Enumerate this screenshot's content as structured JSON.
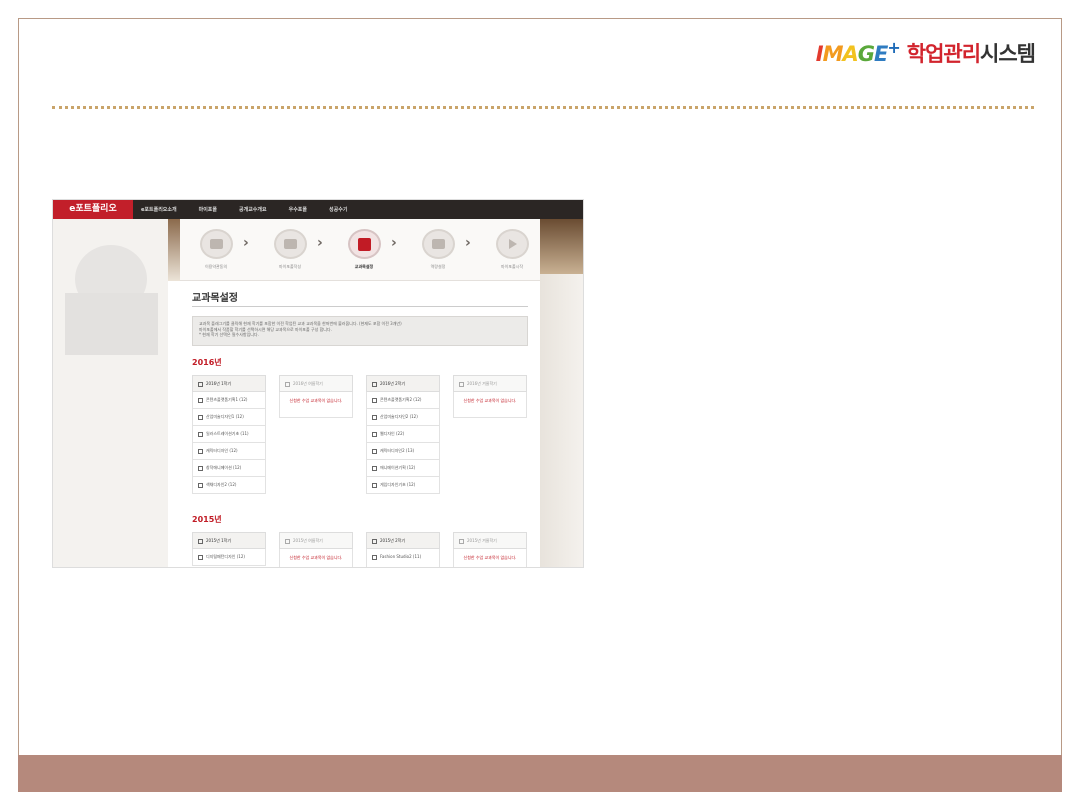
{
  "logo": {
    "brand_letters": [
      {
        "char": "I",
        "color": "#e23a2e"
      },
      {
        "char": "M",
        "color": "#f29a1f"
      },
      {
        "char": "A",
        "color": "#f2c21f"
      },
      {
        "char": "G",
        "color": "#5aa83b"
      },
      {
        "char": "E",
        "color": "#2f7cc1"
      }
    ],
    "plus": "+",
    "system_red": "학업관리",
    "system_dark": "시스템"
  },
  "colors": {
    "accent": "#c11b25",
    "footer": "#b5897c",
    "dotted": "#c9a46a"
  },
  "screenshot": {
    "nav": {
      "brand": "e포트폴리오",
      "menu": [
        "e포트폴리오소개",
        "마이포폴",
        "공개교수개요",
        "우수포폴",
        "성공수기"
      ]
    },
    "steps": [
      {
        "label": "이용약관동의",
        "icon": "check-icon"
      },
      {
        "label": "마이포폴작성",
        "icon": "keyboard-icon"
      },
      {
        "label": "교과목설정",
        "icon": "book-icon",
        "active": true
      },
      {
        "label": "역량설정",
        "icon": "list-icon"
      },
      {
        "label": "마이포폴시작",
        "icon": "play-icon"
      }
    ],
    "page_title": "교과목설정",
    "info_lines": [
      "교과목 플래그기를 클릭해 현재 학기를 포함한 이전 학업된 교과 교과목을 한꺼번에 불러옵니다. (현재도 포함 이전 3개년)",
      "마이포폴에서 작품할 학기를 선택하시면 해당 교과목으로 마이포폴 구성 합니다.",
      "* 현재 학기 선택은 필수사항입니다."
    ],
    "years": [
      {
        "label": "2016년",
        "semesters": [
          {
            "label": "2016년 1학기",
            "muted": false,
            "courses": [
              "콘텐츠플랫폼기획1 (12)",
              "산업미술디자인1 (12)",
              "일러스트레이션기초 (11)",
              "캐릭터디자인 (12)",
              "창작애니메이션 (12)",
              "색채디자인2 (12)"
            ]
          },
          {
            "label": "2016년 여름학기",
            "muted": true,
            "empty_note": "신청한 수업 교과목이 없습니다."
          },
          {
            "label": "2016년 2학기",
            "muted": false,
            "courses": [
              "콘텐츠플랫폼기획2 (12)",
              "산업미술디자인2 (12)",
              "웹디자인 (22)",
              "캐릭터디자인2 (13)",
              "애니메이션기획 (12)",
              "게임디자인기초 (12)"
            ]
          },
          {
            "label": "2016년 겨울학기",
            "muted": true,
            "empty_note": "신청한 수업 교과목이 없습니다."
          }
        ]
      },
      {
        "label": "2015년",
        "semesters": [
          {
            "label": "2015년 1학기",
            "muted": false,
            "courses": [
              "디지털패턴디자인 (12)"
            ]
          },
          {
            "label": "2015년 여름학기",
            "muted": true,
            "empty_note": "신청한 수업 교과목이 없습니다."
          },
          {
            "label": "2015년 2학기",
            "muted": false,
            "courses": [
              "Fashion Studio2 (11)"
            ]
          },
          {
            "label": "2015년 겨울학기",
            "muted": true,
            "empty_note": "신청한 수업 교과목이 없습니다."
          }
        ]
      }
    ]
  }
}
